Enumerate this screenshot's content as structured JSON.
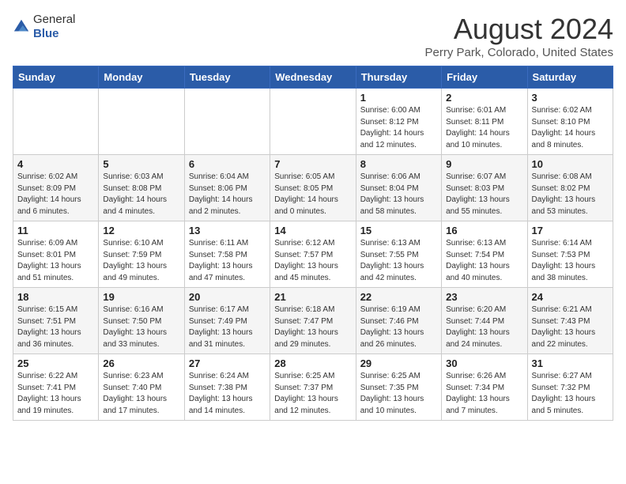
{
  "header": {
    "logo_general": "General",
    "logo_blue": "Blue",
    "title": "August 2024",
    "subtitle": "Perry Park, Colorado, United States"
  },
  "weekdays": [
    "Sunday",
    "Monday",
    "Tuesday",
    "Wednesday",
    "Thursday",
    "Friday",
    "Saturday"
  ],
  "weeks": [
    [
      {
        "day": "",
        "info": ""
      },
      {
        "day": "",
        "info": ""
      },
      {
        "day": "",
        "info": ""
      },
      {
        "day": "",
        "info": ""
      },
      {
        "day": "1",
        "info": "Sunrise: 6:00 AM\nSunset: 8:12 PM\nDaylight: 14 hours\nand 12 minutes."
      },
      {
        "day": "2",
        "info": "Sunrise: 6:01 AM\nSunset: 8:11 PM\nDaylight: 14 hours\nand 10 minutes."
      },
      {
        "day": "3",
        "info": "Sunrise: 6:02 AM\nSunset: 8:10 PM\nDaylight: 14 hours\nand 8 minutes."
      }
    ],
    [
      {
        "day": "4",
        "info": "Sunrise: 6:02 AM\nSunset: 8:09 PM\nDaylight: 14 hours\nand 6 minutes."
      },
      {
        "day": "5",
        "info": "Sunrise: 6:03 AM\nSunset: 8:08 PM\nDaylight: 14 hours\nand 4 minutes."
      },
      {
        "day": "6",
        "info": "Sunrise: 6:04 AM\nSunset: 8:06 PM\nDaylight: 14 hours\nand 2 minutes."
      },
      {
        "day": "7",
        "info": "Sunrise: 6:05 AM\nSunset: 8:05 PM\nDaylight: 14 hours\nand 0 minutes."
      },
      {
        "day": "8",
        "info": "Sunrise: 6:06 AM\nSunset: 8:04 PM\nDaylight: 13 hours\nand 58 minutes."
      },
      {
        "day": "9",
        "info": "Sunrise: 6:07 AM\nSunset: 8:03 PM\nDaylight: 13 hours\nand 55 minutes."
      },
      {
        "day": "10",
        "info": "Sunrise: 6:08 AM\nSunset: 8:02 PM\nDaylight: 13 hours\nand 53 minutes."
      }
    ],
    [
      {
        "day": "11",
        "info": "Sunrise: 6:09 AM\nSunset: 8:01 PM\nDaylight: 13 hours\nand 51 minutes."
      },
      {
        "day": "12",
        "info": "Sunrise: 6:10 AM\nSunset: 7:59 PM\nDaylight: 13 hours\nand 49 minutes."
      },
      {
        "day": "13",
        "info": "Sunrise: 6:11 AM\nSunset: 7:58 PM\nDaylight: 13 hours\nand 47 minutes."
      },
      {
        "day": "14",
        "info": "Sunrise: 6:12 AM\nSunset: 7:57 PM\nDaylight: 13 hours\nand 45 minutes."
      },
      {
        "day": "15",
        "info": "Sunrise: 6:13 AM\nSunset: 7:55 PM\nDaylight: 13 hours\nand 42 minutes."
      },
      {
        "day": "16",
        "info": "Sunrise: 6:13 AM\nSunset: 7:54 PM\nDaylight: 13 hours\nand 40 minutes."
      },
      {
        "day": "17",
        "info": "Sunrise: 6:14 AM\nSunset: 7:53 PM\nDaylight: 13 hours\nand 38 minutes."
      }
    ],
    [
      {
        "day": "18",
        "info": "Sunrise: 6:15 AM\nSunset: 7:51 PM\nDaylight: 13 hours\nand 36 minutes."
      },
      {
        "day": "19",
        "info": "Sunrise: 6:16 AM\nSunset: 7:50 PM\nDaylight: 13 hours\nand 33 minutes."
      },
      {
        "day": "20",
        "info": "Sunrise: 6:17 AM\nSunset: 7:49 PM\nDaylight: 13 hours\nand 31 minutes."
      },
      {
        "day": "21",
        "info": "Sunrise: 6:18 AM\nSunset: 7:47 PM\nDaylight: 13 hours\nand 29 minutes."
      },
      {
        "day": "22",
        "info": "Sunrise: 6:19 AM\nSunset: 7:46 PM\nDaylight: 13 hours\nand 26 minutes."
      },
      {
        "day": "23",
        "info": "Sunrise: 6:20 AM\nSunset: 7:44 PM\nDaylight: 13 hours\nand 24 minutes."
      },
      {
        "day": "24",
        "info": "Sunrise: 6:21 AM\nSunset: 7:43 PM\nDaylight: 13 hours\nand 22 minutes."
      }
    ],
    [
      {
        "day": "25",
        "info": "Sunrise: 6:22 AM\nSunset: 7:41 PM\nDaylight: 13 hours\nand 19 minutes."
      },
      {
        "day": "26",
        "info": "Sunrise: 6:23 AM\nSunset: 7:40 PM\nDaylight: 13 hours\nand 17 minutes."
      },
      {
        "day": "27",
        "info": "Sunrise: 6:24 AM\nSunset: 7:38 PM\nDaylight: 13 hours\nand 14 minutes."
      },
      {
        "day": "28",
        "info": "Sunrise: 6:25 AM\nSunset: 7:37 PM\nDaylight: 13 hours\nand 12 minutes."
      },
      {
        "day": "29",
        "info": "Sunrise: 6:25 AM\nSunset: 7:35 PM\nDaylight: 13 hours\nand 10 minutes."
      },
      {
        "day": "30",
        "info": "Sunrise: 6:26 AM\nSunset: 7:34 PM\nDaylight: 13 hours\nand 7 minutes."
      },
      {
        "day": "31",
        "info": "Sunrise: 6:27 AM\nSunset: 7:32 PM\nDaylight: 13 hours\nand 5 minutes."
      }
    ]
  ]
}
